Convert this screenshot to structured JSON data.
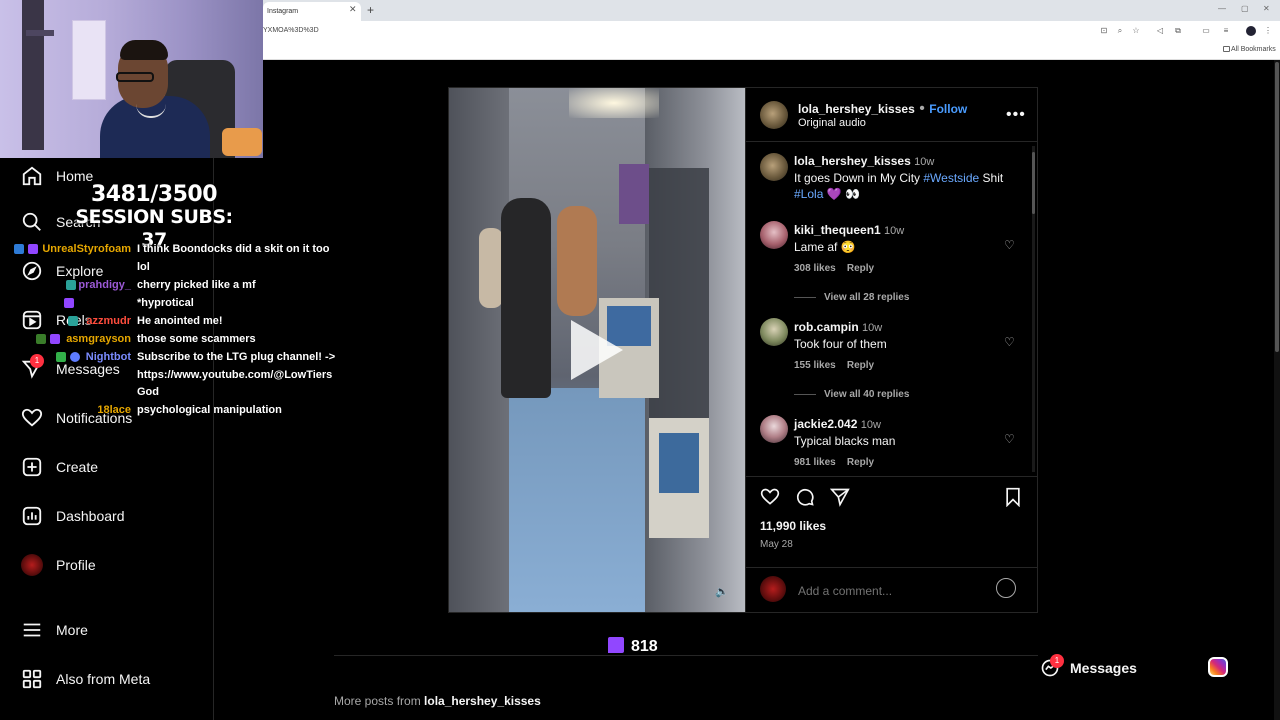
{
  "browser": {
    "tab_title": "Instagram",
    "new_tab": "+",
    "url": "YXMOA%3D%3D",
    "bookmarks_label": "All Bookmarks"
  },
  "overlay": {
    "sub_count": "3481/3500",
    "session_subs": "SESSION SUBS: 37",
    "viewer_count": "818",
    "chat": [
      {
        "user": "UnrealStyrofoam",
        "user_color": "#e6a700",
        "msg": "I think Boondocks did a skit on it too"
      },
      {
        "user": "",
        "user_color": "#ffffff",
        "msg": "lol"
      },
      {
        "user": "prahdigy_",
        "user_color": "#9b59d6",
        "msg": "cherry picked like a mf"
      },
      {
        "user": "",
        "user_color": "#3a3aff",
        "msg": "*hyprotical"
      },
      {
        "user": "azzmudr",
        "user_color": "#ff4d3d",
        "msg": "He anointed me!"
      },
      {
        "user": "asmgrayson",
        "user_color": "#e6a700",
        "msg": "those some scammers"
      },
      {
        "user": "Nightbot",
        "user_color": "#7b8cff",
        "msg": "Subscribe to the LTG plug channel! ->"
      },
      {
        "user": "",
        "user_color": "#ffffff",
        "msg": "https://www.youtube.com/@LowTiers"
      },
      {
        "user": "",
        "user_color": "#ffffff",
        "msg": "God"
      },
      {
        "user": "18lace",
        "user_color": "#e6a700",
        "msg": "psychological manipulation"
      }
    ]
  },
  "sidebar": {
    "items": [
      {
        "label": "Home",
        "icon": "home-icon"
      },
      {
        "label": "Search",
        "icon": "search-icon"
      },
      {
        "label": "Explore",
        "icon": "explore-icon"
      },
      {
        "label": "Reels",
        "icon": "reels-icon"
      },
      {
        "label": "Messages",
        "icon": "messages-icon",
        "badge": "1"
      },
      {
        "label": "Notifications",
        "icon": "heart-icon"
      },
      {
        "label": "Create",
        "icon": "create-icon"
      },
      {
        "label": "Dashboard",
        "icon": "dashboard-icon"
      },
      {
        "label": "Profile",
        "icon": "profile-avatar"
      },
      {
        "label": "More",
        "icon": "menu-icon"
      },
      {
        "label": "Also from Meta",
        "icon": "meta-icon"
      }
    ]
  },
  "post": {
    "author": "lola_hershey_kisses",
    "follow": "Follow",
    "audio": "Original audio",
    "caption": {
      "user": "lola_hershey_kisses",
      "time": "10w",
      "text_before": "It goes Down in My City ",
      "hashtag1": "#Westside",
      "text_mid": " Shit",
      "hashtag2": "#Lola",
      "emoji": "💜 👀"
    },
    "comments": [
      {
        "user": "kiki_thequeen1",
        "time": "10w",
        "text": "Lame af 😳",
        "likes": "308 likes",
        "reply": "Reply",
        "view_replies": "View all 28 replies"
      },
      {
        "user": "rob.campin",
        "time": "10w",
        "text": "Took four of them",
        "likes": "155 likes",
        "reply": "Reply",
        "view_replies": "View all 40 replies"
      },
      {
        "user": "jackie2.042",
        "time": "10w",
        "text": "Typical blacks man",
        "likes": "981 likes",
        "reply": "Reply"
      }
    ],
    "like_count": "11,990 likes",
    "date": "May 28",
    "comment_placeholder": "Add a comment..."
  },
  "footer": {
    "more_posts_prefix": "More posts from ",
    "more_posts_user": "lola_hershey_kisses",
    "messages_label": "Messages",
    "messages_badge": "1"
  }
}
